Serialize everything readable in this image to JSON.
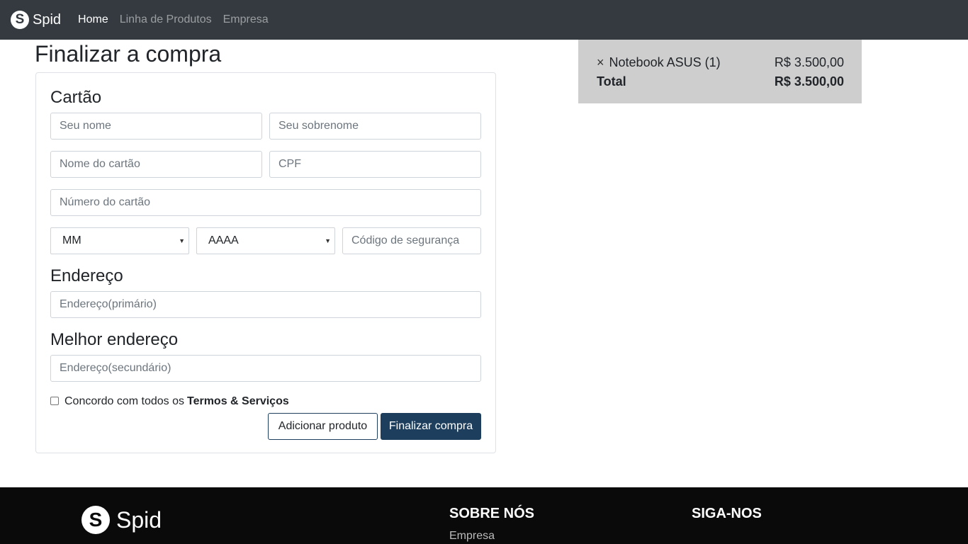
{
  "navbar": {
    "brand": "Spid",
    "logo_letter": "S",
    "links": [
      {
        "label": "Home",
        "active": true
      },
      {
        "label": "Linha de Produtos",
        "active": false
      },
      {
        "label": "Empresa",
        "active": false
      }
    ]
  },
  "page_title": "Finalizar a compra",
  "form": {
    "card_section": "Cartão",
    "first_name_placeholder": "Seu nome",
    "last_name_placeholder": "Seu sobrenome",
    "card_name_placeholder": "Nome do cartão",
    "cpf_placeholder": "CPF",
    "card_number_placeholder": "Número do cartão",
    "month_select": "MM",
    "year_select": "AAAA",
    "security_code_placeholder": "Código de segurança",
    "address_section": "Endereço",
    "address_primary_placeholder": "Endereço(primário)",
    "better_address_section": "Melhor endereço",
    "address_secondary_placeholder": "Endereço(secundário)",
    "terms_prefix": "Concordo com todos os",
    "terms_bold": "Termos & Serviços",
    "add_product_button": "Adicionar produto",
    "finalize_button": "Finalizar compra"
  },
  "cart": {
    "remove_symbol": "×",
    "item_label": "Notebook ASUS (1)",
    "item_price": "R$ 3.500,00",
    "total_label": "Total",
    "total_price": "R$ 3.500,00"
  },
  "footer": {
    "brand": "Spid",
    "logo_letter": "S",
    "about_heading": "SOBRE NÓS",
    "about_link": "Empresa",
    "follow_heading": "SIGA-NOS"
  },
  "colors": {
    "navbar_bg": "#343a40",
    "primary": "#1d3e5c",
    "cart_bg": "#cecece",
    "footer_bg": "#0a0a0a"
  }
}
